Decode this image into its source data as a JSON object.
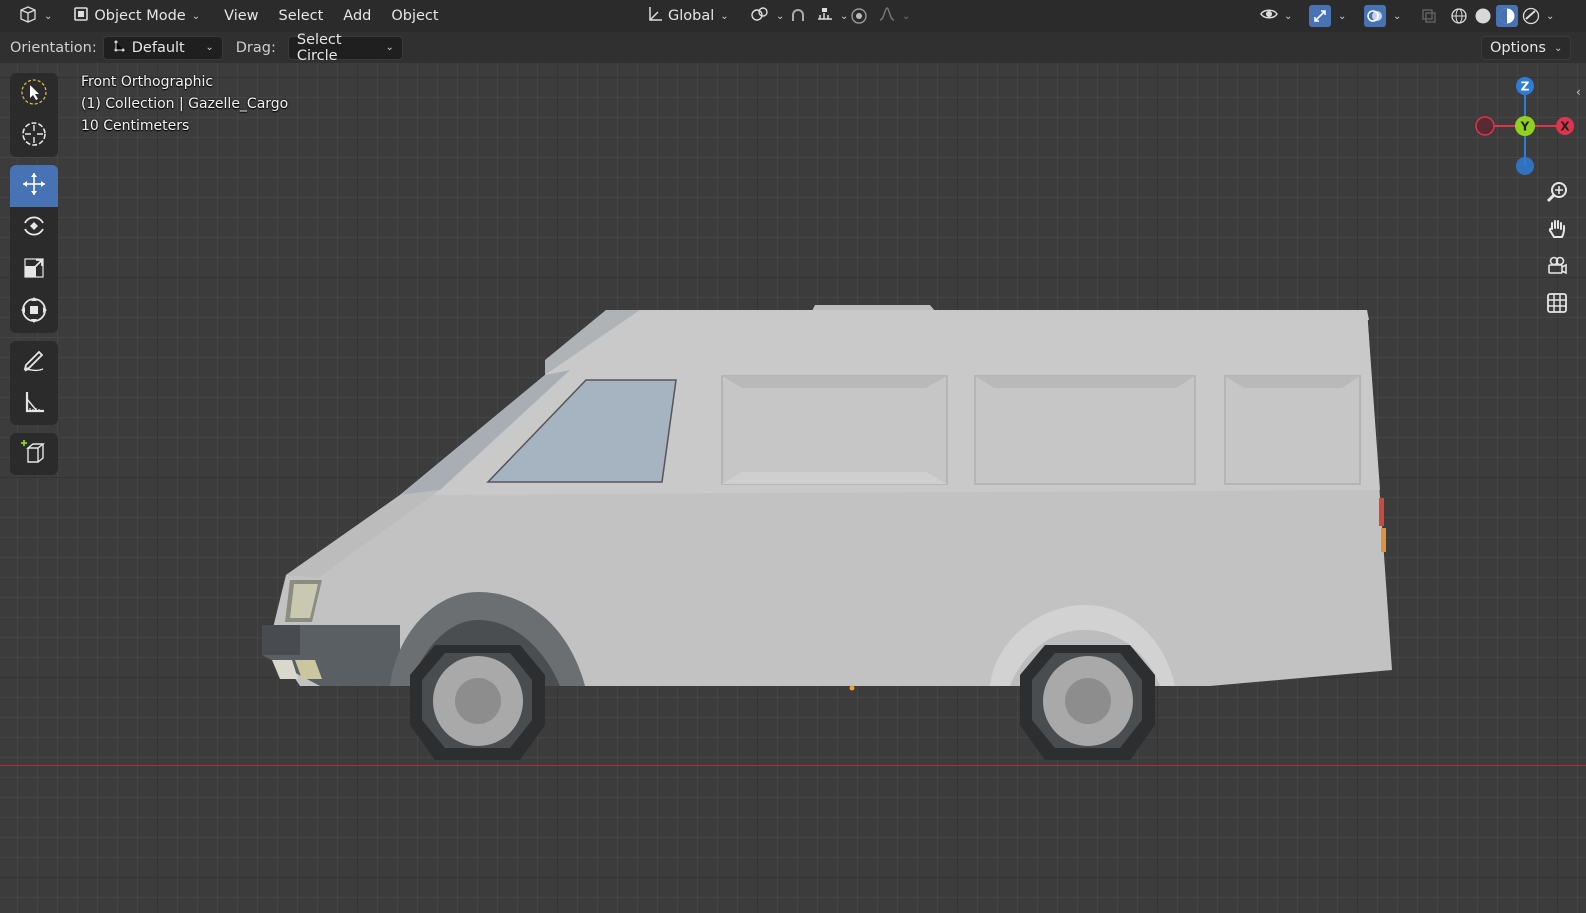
{
  "header": {
    "editor_type_icon": "3d-viewport-icon",
    "mode_label": "Object Mode",
    "menus": [
      "View",
      "Select",
      "Add",
      "Object"
    ],
    "transform_orientation": "Global"
  },
  "tool_settings": {
    "orientation_label": "Orientation:",
    "orientation_value": "Default",
    "drag_label": "Drag:",
    "drag_value": "Select Circle",
    "options_label": "Options"
  },
  "viewport": {
    "view_name": "Front Orthographic",
    "collection_info": "(1) Collection | Gazelle_Cargo",
    "scale_info": "10 Centimeters"
  },
  "tools": [
    {
      "name": "select-box-tool",
      "icon": "cursor-arrow-icon",
      "active": false
    },
    {
      "name": "cursor-tool",
      "icon": "3d-cursor-icon",
      "active": false
    },
    {
      "name": "move-tool",
      "icon": "move-arrows-icon",
      "active": true
    },
    {
      "name": "rotate-tool",
      "icon": "rotate-icon",
      "active": false
    },
    {
      "name": "scale-tool",
      "icon": "scale-icon",
      "active": false
    },
    {
      "name": "transform-tool",
      "icon": "transform-icon",
      "active": false
    },
    {
      "name": "annotate-tool",
      "icon": "annotate-pencil-icon",
      "active": false
    },
    {
      "name": "measure-tool",
      "icon": "ruler-icon",
      "active": false
    },
    {
      "name": "add-cube-tool",
      "icon": "add-cube-icon",
      "active": false
    }
  ],
  "gizmo": {
    "axes": [
      "Z",
      "Y",
      "X"
    ],
    "colors": {
      "x": "#e0344d",
      "y": "#8fd21f",
      "z": "#2f7bd6"
    }
  },
  "colors": {
    "accent": "#4772b3",
    "header_bg": "#2b2b2b",
    "viewport_bg": "#3c3c3c",
    "x_axis_line": "#a3303d"
  }
}
